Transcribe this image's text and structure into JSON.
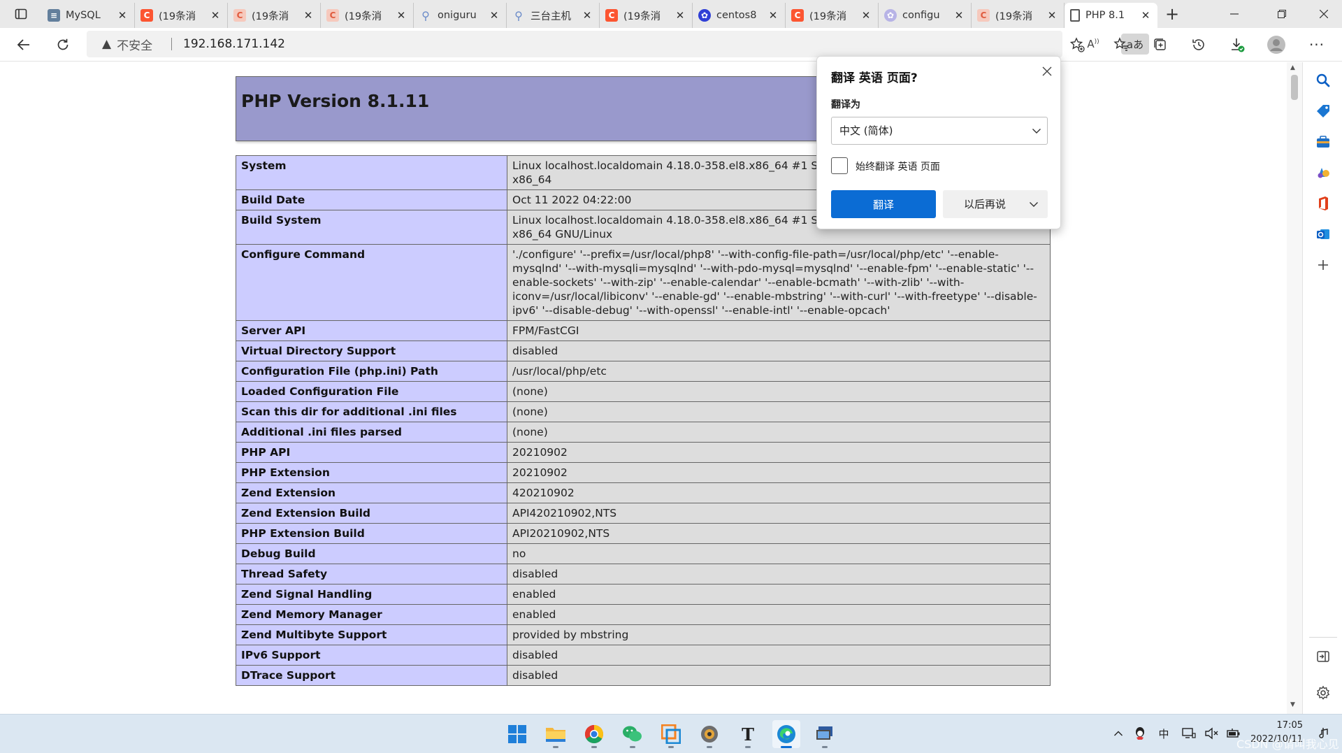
{
  "tabs": [
    {
      "title": "MySQL",
      "favicon": "mysql-doc-icon",
      "active": false
    },
    {
      "title": "(19条消",
      "favicon": "csdn-icon",
      "active": false
    },
    {
      "title": "(19条消",
      "favicon": "csdn-icon",
      "active": false
    },
    {
      "title": "(19条消",
      "favicon": "csdn-icon",
      "active": false
    },
    {
      "title": "oniguru",
      "favicon": "search-icon",
      "active": false
    },
    {
      "title": "三台主机",
      "favicon": "search-icon",
      "active": false
    },
    {
      "title": "(19条消",
      "favicon": "csdn-icon",
      "active": false
    },
    {
      "title": "centos8",
      "favicon": "baidu-icon",
      "active": false
    },
    {
      "title": "(19条消",
      "favicon": "csdn-icon",
      "active": false
    },
    {
      "title": "configu",
      "favicon": "baidu-icon",
      "active": false
    },
    {
      "title": "(19条消",
      "favicon": "csdn-icon",
      "active": false
    },
    {
      "title": "PHP 8.1",
      "favicon": "page-icon",
      "active": true
    }
  ],
  "address_bar": {
    "security_label": "不安全",
    "url": "192.168.171.142"
  },
  "php": {
    "version_title": "PHP Version 8.1.11",
    "rows": [
      {
        "label": "System",
        "value": "Linux localhost.localdomain 4.18.0-358.el8.x86_64 #1 SMP Mon Jan 10 13:11:20 UTC 2022 x86_64"
      },
      {
        "label": "Build Date",
        "value": "Oct 11 2022 04:22:00"
      },
      {
        "label": "Build System",
        "value": "Linux localhost.localdomain 4.18.0-358.el8.x86_64 #1 SMP Mon Jan 10 13:11:20 UTC 2022 x86_64 GNU/Linux"
      },
      {
        "label": "Configure Command",
        "value": "'./configure' '--prefix=/usr/local/php8' '--with-config-file-path=/usr/local/php/etc' '--enable-mysqlnd' '--with-mysqli=mysqlnd' '--with-pdo-mysql=mysqlnd' '--enable-fpm' '--enable-static' '--enable-sockets' '--with-zip' '--enable-calendar' '--enable-bcmath' '--with-zlib' '--with-iconv=/usr/local/libiconv' '--enable-gd' '--enable-mbstring' '--with-curl' '--with-freetype' '--disable-ipv6' '--disable-debug' '--with-openssl' '--enable-intl' '--enable-opcach'"
      },
      {
        "label": "Server API",
        "value": "FPM/FastCGI"
      },
      {
        "label": "Virtual Directory Support",
        "value": "disabled"
      },
      {
        "label": "Configuration File (php.ini) Path",
        "value": "/usr/local/php/etc"
      },
      {
        "label": "Loaded Configuration File",
        "value": "(none)"
      },
      {
        "label": "Scan this dir for additional .ini files",
        "value": "(none)"
      },
      {
        "label": "Additional .ini files parsed",
        "value": "(none)"
      },
      {
        "label": "PHP API",
        "value": "20210902"
      },
      {
        "label": "PHP Extension",
        "value": "20210902"
      },
      {
        "label": "Zend Extension",
        "value": "420210902"
      },
      {
        "label": "Zend Extension Build",
        "value": "API420210902,NTS"
      },
      {
        "label": "PHP Extension Build",
        "value": "API20210902,NTS"
      },
      {
        "label": "Debug Build",
        "value": "no"
      },
      {
        "label": "Thread Safety",
        "value": "disabled"
      },
      {
        "label": "Zend Signal Handling",
        "value": "enabled"
      },
      {
        "label": "Zend Memory Manager",
        "value": "enabled"
      },
      {
        "label": "Zend Multibyte Support",
        "value": "provided by mbstring"
      },
      {
        "label": "IPv6 Support",
        "value": "disabled"
      },
      {
        "label": "DTrace Support",
        "value": "disabled"
      }
    ]
  },
  "translate_popup": {
    "title": "翻译 英语 页面?",
    "target_label": "翻译为",
    "target_value": "中文 (简体)",
    "always_label": "始终翻译 英语 页面",
    "always_checked": false,
    "translate_button": "翻译",
    "later_button": "以后再说"
  },
  "sidebar_icons": [
    "search-icon",
    "shopping-tag-icon",
    "tools-briefcase-icon",
    "games-icon",
    "office-icon",
    "outlook-icon",
    "add-icon",
    "split-screen-icon",
    "settings-icon"
  ],
  "taskbar": {
    "apps": [
      "windows-start-icon",
      "file-explorer-icon",
      "chrome-icon",
      "wechat-icon",
      "vmware-icon",
      "app-icon",
      "typora-icon",
      "edge-icon",
      "remote-desktop-icon"
    ],
    "ime": "中",
    "time": "17:05",
    "date": "2022/10/11",
    "watermark": "CSDN @请叫我心见"
  },
  "colors": {
    "php_header": "#9999cc",
    "php_label_cell": "#ccccff",
    "php_value_cell": "#dddddd",
    "translate_button": "#0b6cd4",
    "taskbar": "#dbe7f2"
  }
}
